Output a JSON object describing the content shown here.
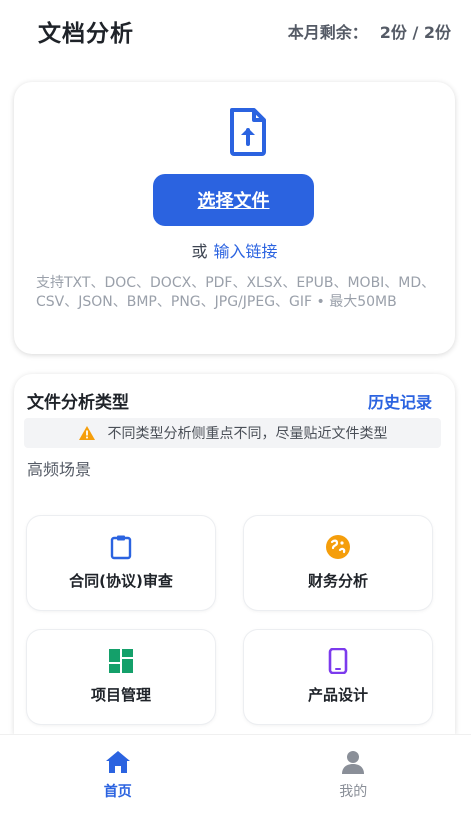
{
  "header": {
    "title": "文档分析",
    "quota_label": "本月剩余：",
    "quota_value": "2份 / 2份"
  },
  "upload": {
    "icon": "file-upload-icon",
    "choose_button": "选择文件",
    "or_text": "或",
    "link_text": "输入链接",
    "formats": "支持TXT、DOC、DOCX、PDF、XLSX、EPUB、MOBI、MD、CSV、JSON、BMP、PNG、JPG/JPEG、GIF • 最大50MB"
  },
  "analysis": {
    "title": "文件分析类型",
    "history": "历史记录",
    "tip": "不同类型分析侧重点不同，尽量贴近文件类型",
    "scene_label": "高频场景",
    "items": [
      {
        "label": "合同(协议)审查",
        "icon": "clipboard-icon",
        "color": "#2b63e0"
      },
      {
        "label": "财务分析",
        "icon": "coin-icon",
        "color": "#f59e0b"
      },
      {
        "label": "项目管理",
        "icon": "dashboard-icon",
        "color": "#14a06a"
      },
      {
        "label": "产品设计",
        "icon": "phone-icon",
        "color": "#7c3aed"
      }
    ]
  },
  "nav": {
    "home": "首页",
    "mine": "我的"
  },
  "colors": {
    "accent": "#2b63e0",
    "warning": "#f59e0b"
  }
}
